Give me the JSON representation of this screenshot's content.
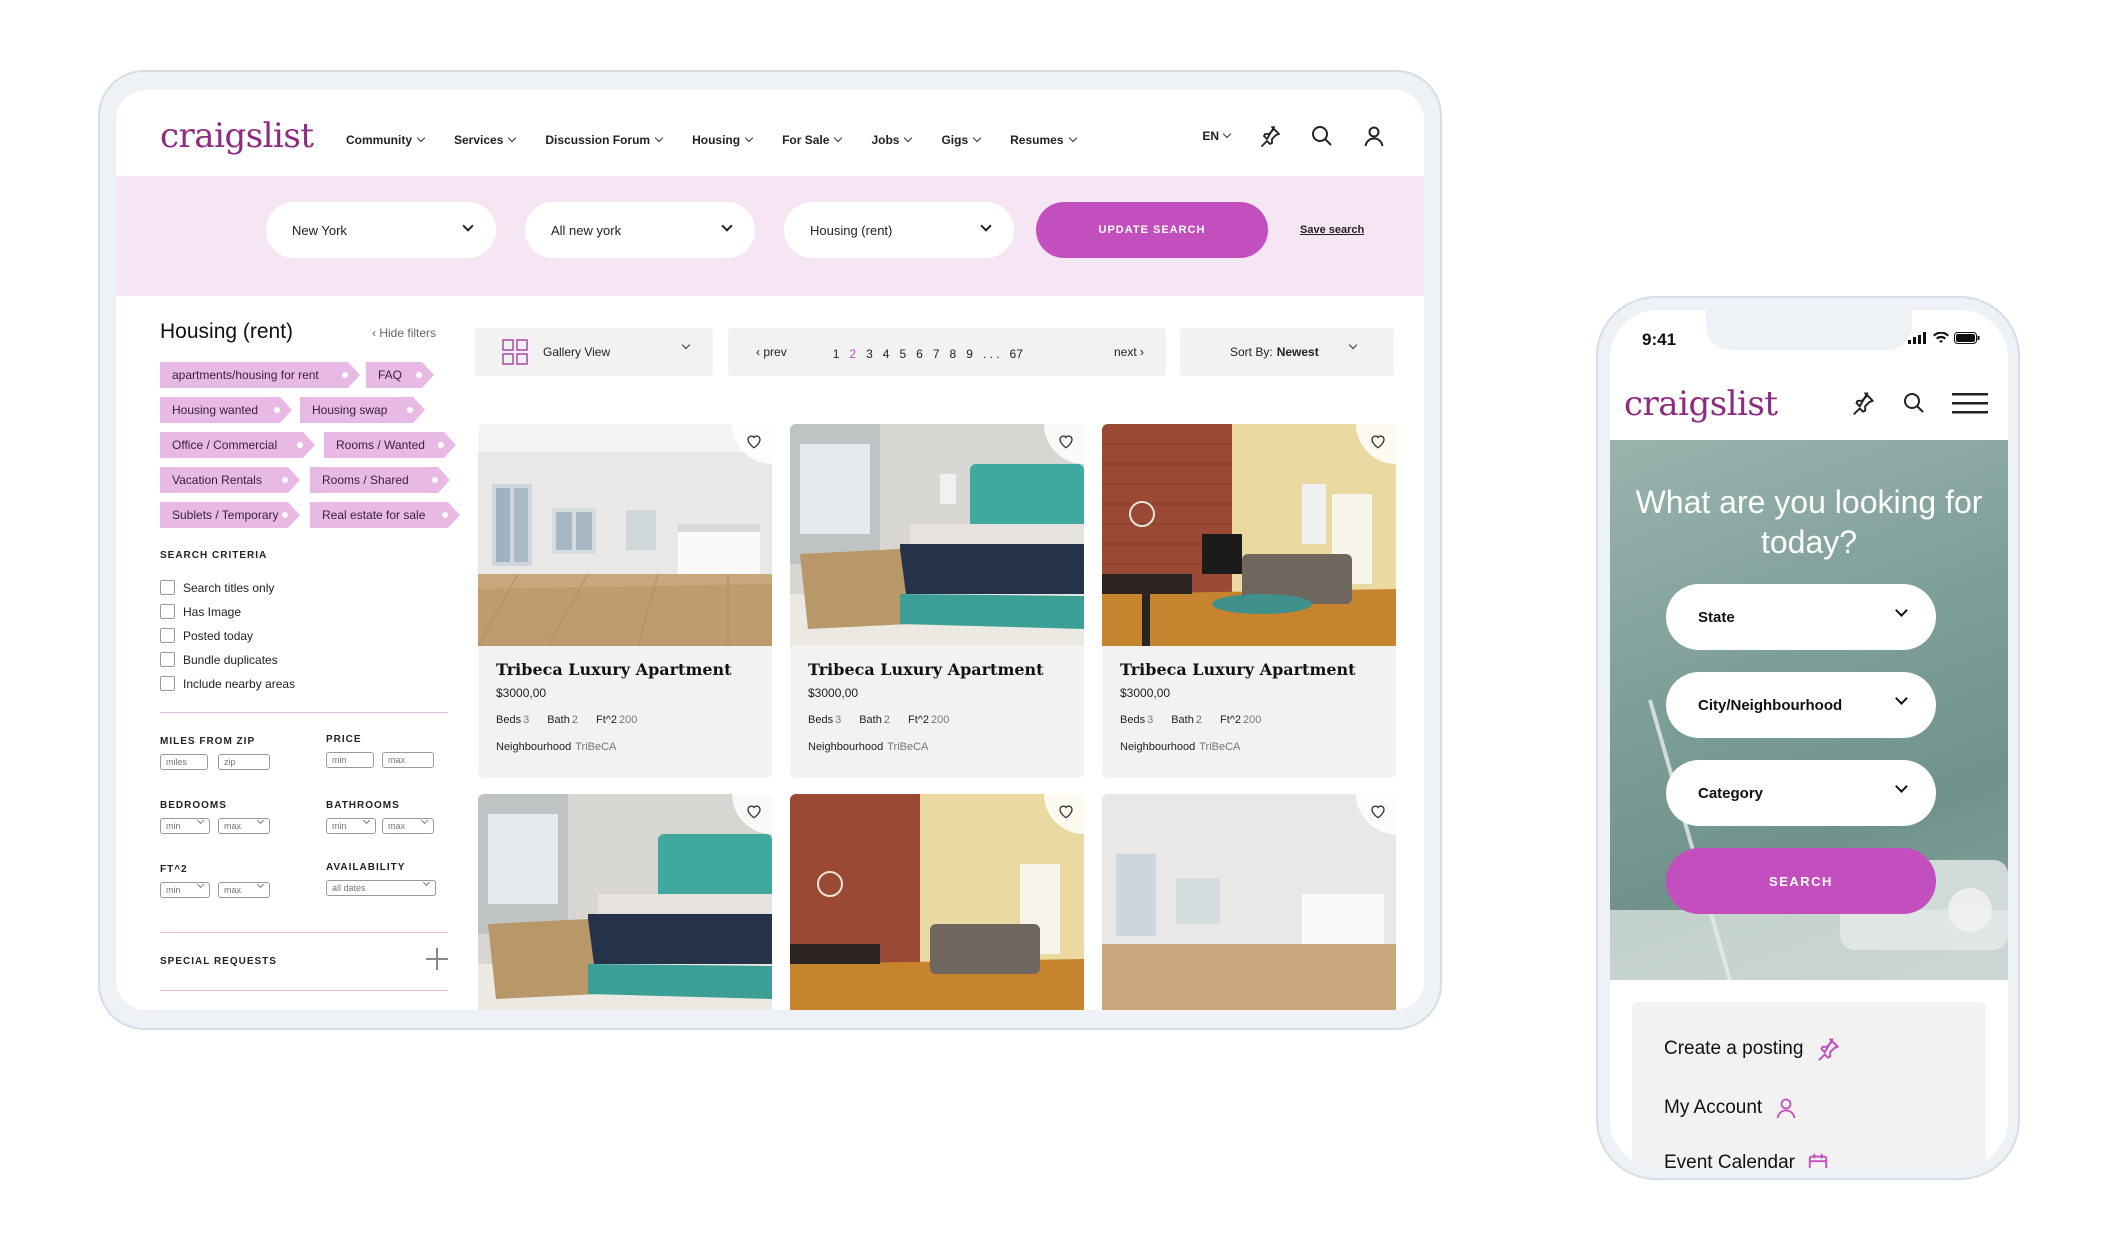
{
  "tablet": {
    "logo": "craigslist",
    "nav": [
      "Community",
      "Services",
      "Discussion Forum",
      "Housing",
      "For Sale",
      "Jobs",
      "Gigs",
      "Resumes"
    ],
    "lang": "EN",
    "search": {
      "location": "New York",
      "area": "All new york",
      "category": "Housing (rent)",
      "update_label": "UPDATE SEARCH",
      "save_label": "Save search"
    },
    "filters": {
      "title": "Housing (rent)",
      "hide_label": "Hide filters",
      "tags": [
        "apartments/housing for rent",
        "FAQ",
        "Housing wanted",
        "Housing swap",
        "Office / Commercial",
        "Rooms / Wanted",
        "Vacation Rentals",
        "Rooms / Shared",
        "Sublets / Temporary",
        "Real estate for sale"
      ],
      "criteria_title": "SEARCH CRITERIA",
      "criteria": [
        "Search titles only",
        "Has Image",
        "Posted today",
        "Bundle duplicates",
        "Include nearby areas"
      ],
      "miles_label": "MILES FROM ZIP",
      "miles_placeholder": "miles",
      "zip_placeholder": "zip",
      "price_label": "PRICE",
      "min": "min",
      "max": "max",
      "bedrooms_label": "BEDROOMS",
      "bathrooms_label": "BATHROOMS",
      "ft_label": "FT^2",
      "availability_label": "AVAILABILITY",
      "availability_value": "all dates",
      "special_label": "SPECIAL REQUESTS"
    },
    "toolbar": {
      "view": "Gallery View",
      "prev": "prev",
      "next": "next",
      "pages": [
        "1",
        "2",
        "3",
        "4",
        "5",
        "6",
        "7",
        "8",
        "9",
        ". . .",
        "67"
      ],
      "current_page": "2",
      "sort_prefix": "Sort By:",
      "sort_value": "Newest"
    },
    "listings": [
      {
        "title": "Tribeca Luxury Apartment",
        "price": "$3000,00",
        "beds_label": "Beds",
        "beds": "3",
        "bath_label": "Bath",
        "bath": "2",
        "ft_label": "Ft^2",
        "ft": "200",
        "neigh_label": "Neighbourhood",
        "neigh": "TriBeCA",
        "photo": "empty-apartment"
      },
      {
        "title": "Tribeca Luxury Apartment",
        "price": "$3000,00",
        "beds_label": "Beds",
        "beds": "3",
        "bath_label": "Bath",
        "bath": "2",
        "ft_label": "Ft^2",
        "ft": "200",
        "neigh_label": "Neighbourhood",
        "neigh": "TriBeCA",
        "photo": "bedroom"
      },
      {
        "title": "Tribeca Luxury Apartment",
        "price": "$3000,00",
        "beds_label": "Beds",
        "beds": "3",
        "bath_label": "Bath",
        "bath": "2",
        "ft_label": "Ft^2",
        "ft": "200",
        "neigh_label": "Neighbourhood",
        "neigh": "TriBeCA",
        "photo": "living-room"
      }
    ],
    "listings_row2_photos": [
      "bedroom",
      "living-room",
      "empty-apartment"
    ]
  },
  "phone": {
    "time": "9:41",
    "logo": "craigslist",
    "hero_title": "What are you looking for today?",
    "selects": [
      "State",
      "City/Neighbourhood",
      "Category"
    ],
    "search_label": "SEARCH",
    "menu": [
      "Create a posting",
      "My Account",
      "Event Calendar"
    ]
  },
  "colors": {
    "brand": "#8e2a82",
    "accent": "#c24fbd",
    "tag": "#e8b9e4",
    "band": "#f6e6f4"
  }
}
